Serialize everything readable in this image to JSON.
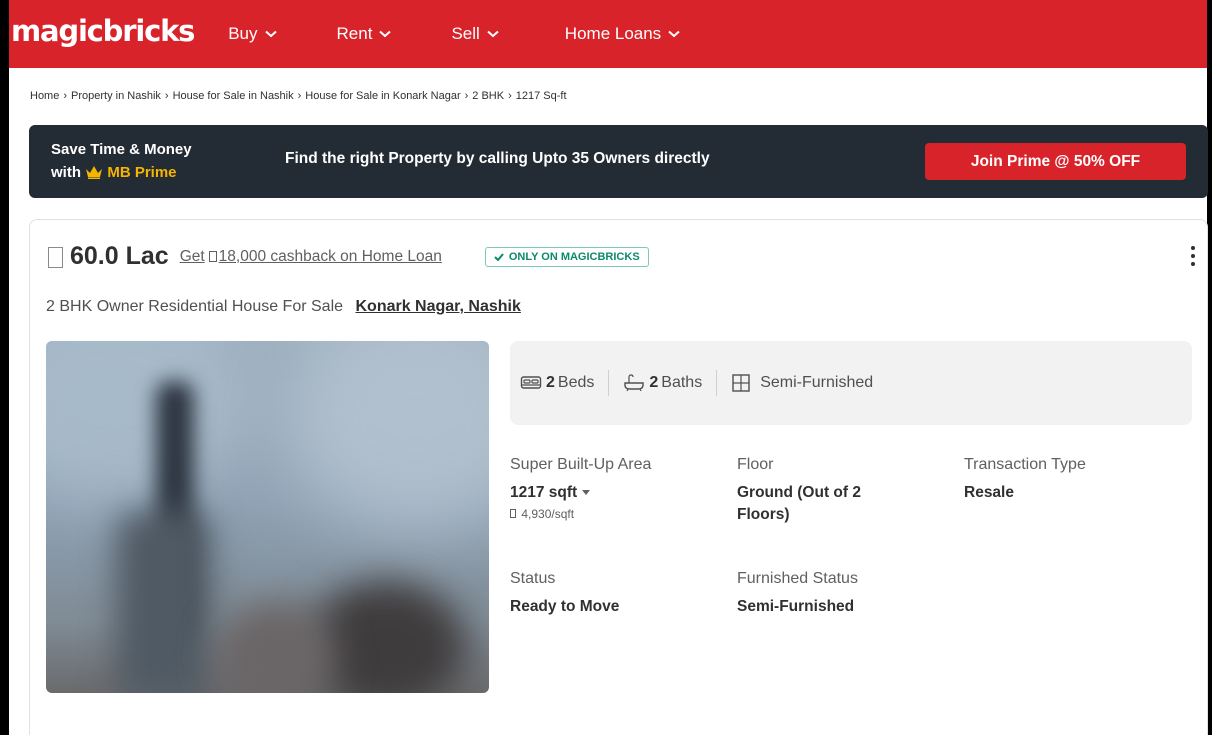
{
  "header": {
    "logo": "magicbricks",
    "nav": [
      {
        "label": "Buy"
      },
      {
        "label": "Rent"
      },
      {
        "label": "Sell"
      },
      {
        "label": "Home Loans"
      }
    ]
  },
  "breadcrumb": [
    "Home",
    "Property in Nashik",
    "House for Sale in Nashik",
    "House for Sale in Konark Nagar",
    "2 BHK",
    "1217 Sq-ft"
  ],
  "prime_banner": {
    "line1": "Save Time & Money",
    "line2_prefix": "with",
    "brand": "MB Prime",
    "message": "Find the right Property by calling Upto 35 Owners directly",
    "cta": "Join Prime @ 50% OFF"
  },
  "listing": {
    "price": "60.0 Lac",
    "cashback_prefix": "Get",
    "cashback_amount": "18,000 cashback on Home Loan",
    "badge": "ONLY ON MAGICBRICKS",
    "title": "2 BHK Owner Residential House For Sale",
    "locality": "Konark Nagar, Nashik",
    "specs": {
      "beds_count": "2",
      "beds_label": "Beds",
      "baths_count": "2",
      "baths_label": "Baths",
      "furnishing": "Semi-Furnished"
    },
    "details": {
      "area_label": "Super Built-Up Area",
      "area_value": "1217 sqft",
      "area_rate": "4,930/sqft",
      "floor_label": "Floor",
      "floor_value": "Ground (Out of 2 Floors)",
      "transaction_label": "Transaction Type",
      "transaction_value": "Resale",
      "status_label": "Status",
      "status_value": "Ready to Move",
      "furnished_label": "Furnished Status",
      "furnished_value": "Semi-Furnished"
    }
  },
  "colors": {
    "brand_red": "#d8232a",
    "banner_dark": "#232b34",
    "prime_gold": "#f4b400",
    "badge_green": "#0b8a69"
  }
}
